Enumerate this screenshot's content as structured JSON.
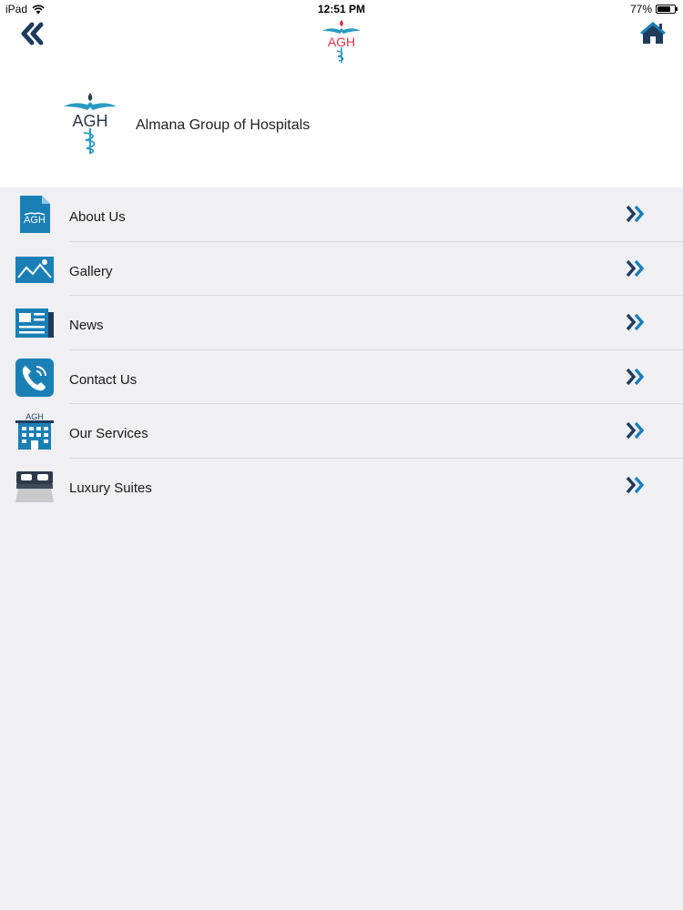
{
  "status_bar": {
    "device": "iPad",
    "time": "12:51 PM",
    "battery": "77%",
    "battery_level": 0.77
  },
  "nav": {
    "logo_text": "AGH",
    "icons": {
      "back": "double-chevron-left-icon",
      "home": "home-icon"
    }
  },
  "header": {
    "logo_text": "AGH",
    "title": "Almana Group of Hospitals"
  },
  "menu": {
    "items": [
      {
        "label": "About Us",
        "icon": "document-agh-icon"
      },
      {
        "label": "Gallery",
        "icon": "landscape-image-icon"
      },
      {
        "label": "News",
        "icon": "newspaper-icon"
      },
      {
        "label": "Contact Us",
        "icon": "phone-icon"
      },
      {
        "label": "Our Services",
        "icon": "hospital-building-icon"
      },
      {
        "label": "Luxury Suites",
        "icon": "bed-icon"
      }
    ]
  },
  "colors": {
    "accent": "#1a7fb5",
    "dark": "#2d3a4a",
    "logo_red": "#d8344a",
    "logo_teal": "#2a9bbf",
    "background": "#efeff4"
  }
}
